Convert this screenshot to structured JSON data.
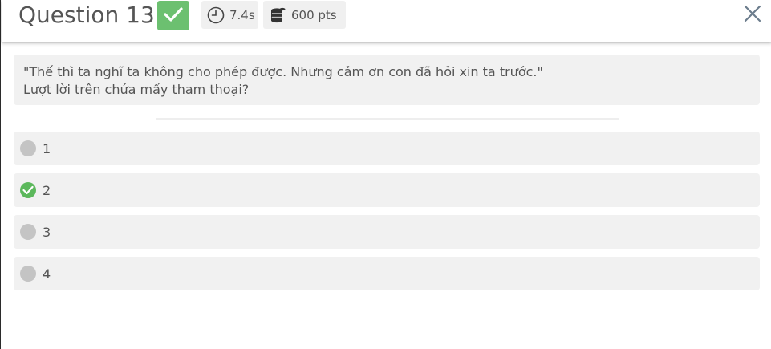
{
  "header": {
    "title": "Question 13",
    "status_icon": "check-icon",
    "status_color": "#6cc070",
    "time": "7.4s",
    "time_icon": "clock-icon",
    "points": "600 pts",
    "points_icon": "coins-icon",
    "close_icon": "close-icon"
  },
  "question": {
    "line1": "\"Thế thì ta nghĩ ta không cho phép được. Nhưng cảm ơn con đã hỏi xin ta trước.\"",
    "line2": "Lượt lời trên chứa mấy tham thoại?"
  },
  "options": [
    {
      "label": "1",
      "state": "unselected"
    },
    {
      "label": "2",
      "state": "correct"
    },
    {
      "label": "3",
      "state": "unselected"
    },
    {
      "label": "4",
      "state": "unselected"
    }
  ],
  "colors": {
    "correct": "#5cb85c",
    "neutral": "#c4c4c4",
    "panel": "#f1f1f1"
  }
}
